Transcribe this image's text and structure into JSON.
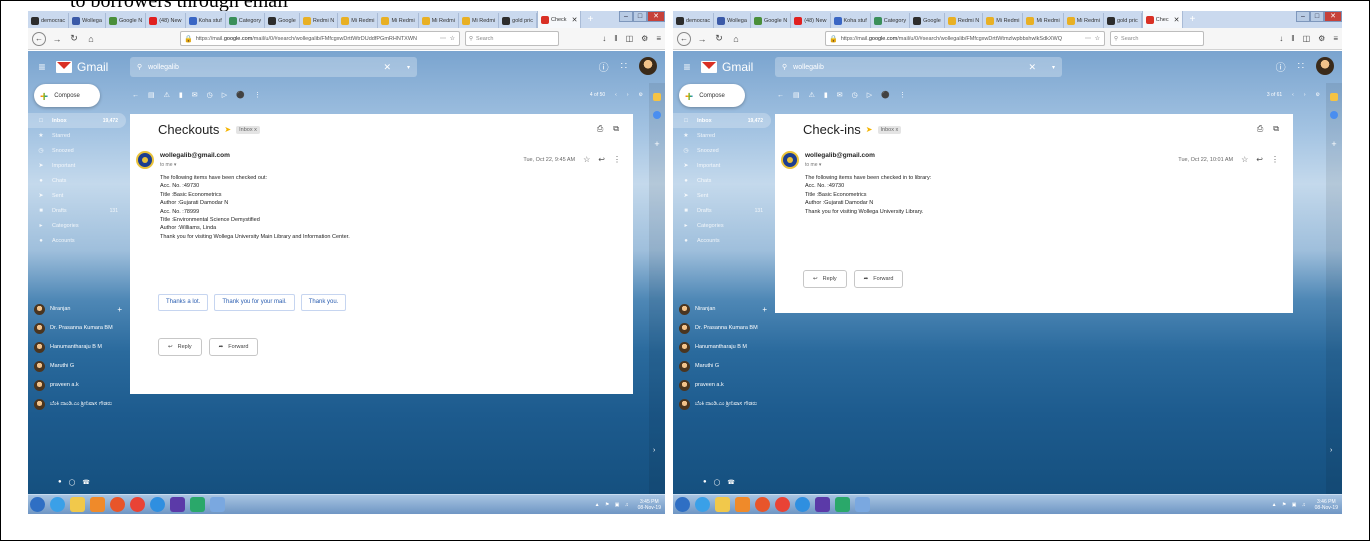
{
  "caption": "to borrowers through email",
  "windows": [
    {
      "tabs": [
        {
          "label": "democrac",
          "color": "#2d2d2d"
        },
        {
          "label": "Wollega",
          "color": "#3b5aa8"
        },
        {
          "label": "Google N",
          "color": "#4a8f3a"
        },
        {
          "label": "(48) New",
          "color": "#e02020"
        },
        {
          "label": "Koha stuf",
          "color": "#3a66c4"
        },
        {
          "label": "Category",
          "color": "#3a8f5a"
        },
        {
          "label": "Google",
          "color": "#2d2d2d"
        },
        {
          "label": "Redmi N",
          "color": "#e8b024"
        },
        {
          "label": "Mi Redmi",
          "color": "#e8b024"
        },
        {
          "label": "Mi Redmi",
          "color": "#e8b024"
        },
        {
          "label": "Mi Redmi",
          "color": "#e8b024"
        },
        {
          "label": "Mi Redmi",
          "color": "#e8b024"
        },
        {
          "label": "gold pric",
          "color": "#2d2d2d"
        },
        {
          "label": "Check",
          "color": "#d93025",
          "active": true
        }
      ],
      "url_prefix": "https://mail.",
      "url_domain": "google.com",
      "url_rest": "/mail/u/0/#search/wollegalib/FMfcgxwDrttWtrDUddfPGmRHNTXWN",
      "search_placeholder": "Search",
      "gmail_label": "Gmail",
      "gmail_search_value": "wollegalib",
      "compose_label": "Compose",
      "sidebar": [
        {
          "label": "Inbox",
          "count": "19,472",
          "icon": "□",
          "active": true
        },
        {
          "label": "Starred",
          "count": "",
          "icon": "★"
        },
        {
          "label": "Snoozed",
          "count": "",
          "icon": "◷"
        },
        {
          "label": "Important",
          "count": "",
          "icon": "➤"
        },
        {
          "label": "Chats",
          "count": "",
          "icon": "●"
        },
        {
          "label": "Sent",
          "count": "",
          "icon": "➤"
        },
        {
          "label": "Drafts",
          "count": "131",
          "icon": "■"
        },
        {
          "label": "Categories",
          "count": "",
          "icon": "▸"
        },
        {
          "label": "Accounts",
          "count": "",
          "icon": "●"
        }
      ],
      "hangouts": [
        {
          "label": "Niranjan",
          "extra": "+"
        },
        {
          "label": "Dr. Prasanna Kumara BM",
          "extra": ""
        },
        {
          "label": "Hanumantharaju B M",
          "extra": ""
        },
        {
          "label": "Maruthi G",
          "extra": ""
        },
        {
          "label": "praveen a.k",
          "extra": ""
        },
        {
          "label": "ಬೆಂಕಿ ದಾಂಡಿ.ಎಂ  ಶ್ರೀನಿವಾಸ ಗೌಡರು",
          "extra": ""
        }
      ],
      "pager": "4 of 50",
      "subject": "Checkouts",
      "label_chip": "Inbox x",
      "sender": "wollegalib@gmail.com",
      "to": "to me ▾",
      "date": "Tue, Oct 22, 9:45 AM",
      "body": [
        "The following items have been checked out:",
        "Acc. No. :49730",
        "Title :Basic Econometrics",
        "Author :Gujarati Damodar N",
        "Acc. No. :78999",
        "Title :Environmental Science Demystified",
        "Author :Williams, Linda",
        "Thank you for visiting Wollega University Main Library and Information Center."
      ],
      "smart_replies": [
        "Thanks a lot.",
        "Thank you for your mail.",
        "Thank you."
      ],
      "reply_label": "Reply",
      "forward_label": "Forward",
      "clock_time": "3:45 PM",
      "clock_date": "08-Nov-19"
    },
    {
      "tabs": [
        {
          "label": "democrac",
          "color": "#2d2d2d"
        },
        {
          "label": "Wollega",
          "color": "#3b5aa8"
        },
        {
          "label": "Google N",
          "color": "#4a8f3a"
        },
        {
          "label": "(48) New",
          "color": "#e02020"
        },
        {
          "label": "Koha stuf",
          "color": "#3a66c4"
        },
        {
          "label": "Category",
          "color": "#3a8f5a"
        },
        {
          "label": "Google",
          "color": "#2d2d2d"
        },
        {
          "label": "Redmi N",
          "color": "#e8b024"
        },
        {
          "label": "Mi Redmi",
          "color": "#e8b024"
        },
        {
          "label": "Mi Redmi",
          "color": "#e8b024"
        },
        {
          "label": "Mi Redmi",
          "color": "#e8b024"
        },
        {
          "label": "gold pric",
          "color": "#2d2d2d"
        },
        {
          "label": "Chec",
          "color": "#d93025",
          "active": true
        }
      ],
      "url_prefix": "https://mail.",
      "url_domain": "google.com",
      "url_rest": "/mail/u/0/#search/wollegalib/FMfcgxwDrttWtmzlwpbbshwlkSdkXWQ",
      "search_placeholder": "Search",
      "gmail_label": "Gmail",
      "gmail_search_value": "wollegalib",
      "compose_label": "Compose",
      "sidebar": [
        {
          "label": "Inbox",
          "count": "19,472",
          "icon": "□",
          "active": true
        },
        {
          "label": "Starred",
          "count": "",
          "icon": "★"
        },
        {
          "label": "Snoozed",
          "count": "",
          "icon": "◷"
        },
        {
          "label": "Important",
          "count": "",
          "icon": "➤"
        },
        {
          "label": "Chats",
          "count": "",
          "icon": "●"
        },
        {
          "label": "Sent",
          "count": "",
          "icon": "➤"
        },
        {
          "label": "Drafts",
          "count": "131",
          "icon": "■"
        },
        {
          "label": "Categories",
          "count": "",
          "icon": "▸"
        },
        {
          "label": "Accounts",
          "count": "",
          "icon": "●"
        }
      ],
      "hangouts": [
        {
          "label": "Niranjan",
          "extra": "+"
        },
        {
          "label": "Dr. Prasanna Kumara BM",
          "extra": ""
        },
        {
          "label": "Hanumantharaju B M",
          "extra": ""
        },
        {
          "label": "Maruthi G",
          "extra": ""
        },
        {
          "label": "praveen a.k",
          "extra": ""
        },
        {
          "label": "ಬೆಂಕಿ ದಾಂಡಿ.ಎಂ  ಶ್ರೀನಿವಾಸ ಗೌಡರು",
          "extra": ""
        }
      ],
      "pager": "3 of 61",
      "subject": "Check-ins",
      "label_chip": "Inbox x",
      "sender": "wollegalib@gmail.com",
      "to": "to me ▾",
      "date": "Tue, Oct 22, 10:01 AM",
      "body": [
        "The following items have been checked in to library:",
        "Acc. No. :49730",
        "Title :Basic Econometrics",
        "Author :Gujarati Damodar N",
        "Thank you for visiting Wollega University Library."
      ],
      "smart_replies": [],
      "reply_label": "Reply",
      "forward_label": "Forward",
      "clock_time": "3:46 PM",
      "clock_date": "08-Nov-19"
    }
  ],
  "taskbar_icons": [
    {
      "name": "start-orb-icon",
      "color": "#2f6fc4",
      "round": true
    },
    {
      "name": "ie-icon",
      "color": "#3aa0e8",
      "round": true
    },
    {
      "name": "explorer-icon",
      "color": "#f1c84b"
    },
    {
      "name": "media-icon",
      "color": "#ef8a2a"
    },
    {
      "name": "firefox-icon",
      "color": "#e8552a",
      "round": true
    },
    {
      "name": "chrome-icon",
      "color": "#e94335",
      "round": true
    },
    {
      "name": "opera-icon",
      "color": "#2f8fe0",
      "round": true
    },
    {
      "name": "play-icon",
      "color": "#5b3aa8"
    },
    {
      "name": "app-icon",
      "color": "#2aa86a"
    },
    {
      "name": "notepad-icon",
      "color": "#7aa8e0"
    }
  ]
}
